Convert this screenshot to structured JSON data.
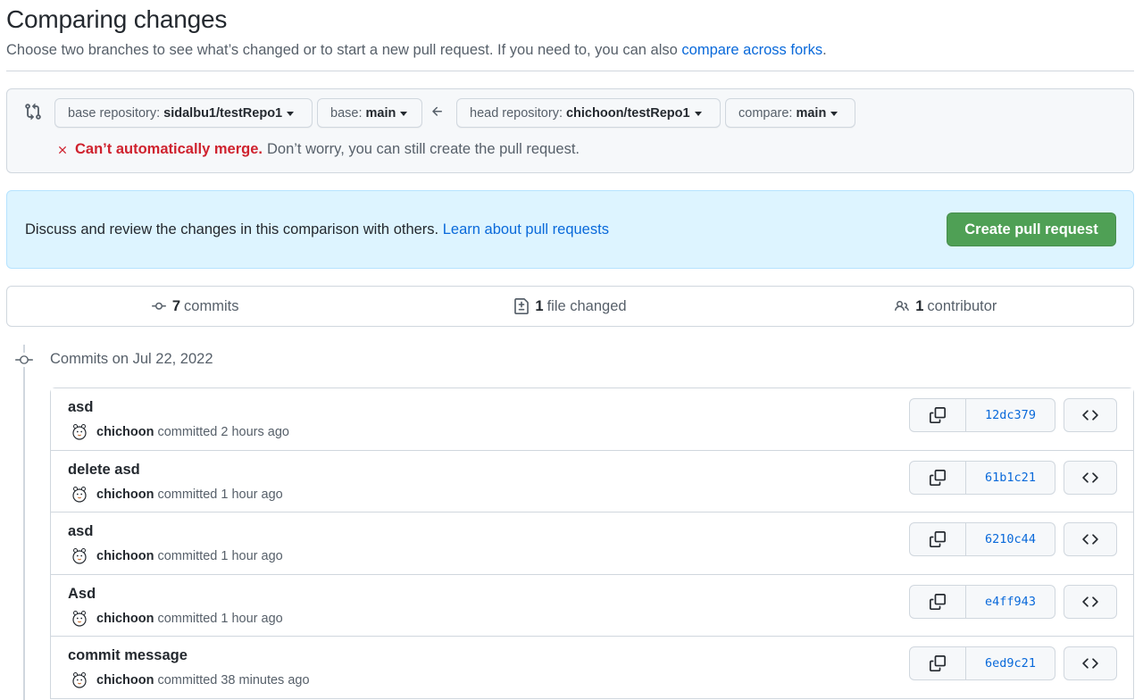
{
  "header": {
    "title": "Comparing changes",
    "description": "Choose two branches to see what’s changed or to start a new pull request. If you need to, you can also ",
    "description_link": "compare across forks",
    "description_suffix": "."
  },
  "range": {
    "base_repo_label": "base repository:",
    "base_repo_value": "sidalbu1/testRepo1",
    "base_label": "base:",
    "base_value": "main",
    "head_repo_label": "head repository:",
    "head_repo_value": "chichoon/testRepo1",
    "compare_label": "compare:",
    "compare_value": "main",
    "merge_status_strong": "Can’t automatically merge.",
    "merge_status_text": "Don’t worry, you can still create the pull request."
  },
  "info": {
    "text": "Discuss and review the changes in this comparison with others. ",
    "link": "Learn about pull requests",
    "button": "Create pull request"
  },
  "summary": {
    "commits_count": "7",
    "commits_label": "commits",
    "files_count": "1",
    "files_label": "file changed",
    "contributors_count": "1",
    "contributors_label": "contributor"
  },
  "timeline": {
    "date_heading": "Commits on Jul 22, 2022"
  },
  "commits": [
    {
      "message": "asd",
      "author": "chichoon",
      "time": "committed 2 hours ago",
      "sha": "12dc379"
    },
    {
      "message": "delete asd",
      "author": "chichoon",
      "time": "committed 1 hour ago",
      "sha": "61b1c21"
    },
    {
      "message": "asd",
      "author": "chichoon",
      "time": "committed 1 hour ago",
      "sha": "6210c44"
    },
    {
      "message": "Asd",
      "author": "chichoon",
      "time": "committed 1 hour ago",
      "sha": "e4ff943"
    },
    {
      "message": "commit message",
      "author": "chichoon",
      "time": "committed 38 minutes ago",
      "sha": "6ed9c21"
    }
  ],
  "colors": {
    "link": "#0969da",
    "error": "#cf222e",
    "success_button": "#4fa055",
    "info_bg": "#ddf4ff"
  }
}
